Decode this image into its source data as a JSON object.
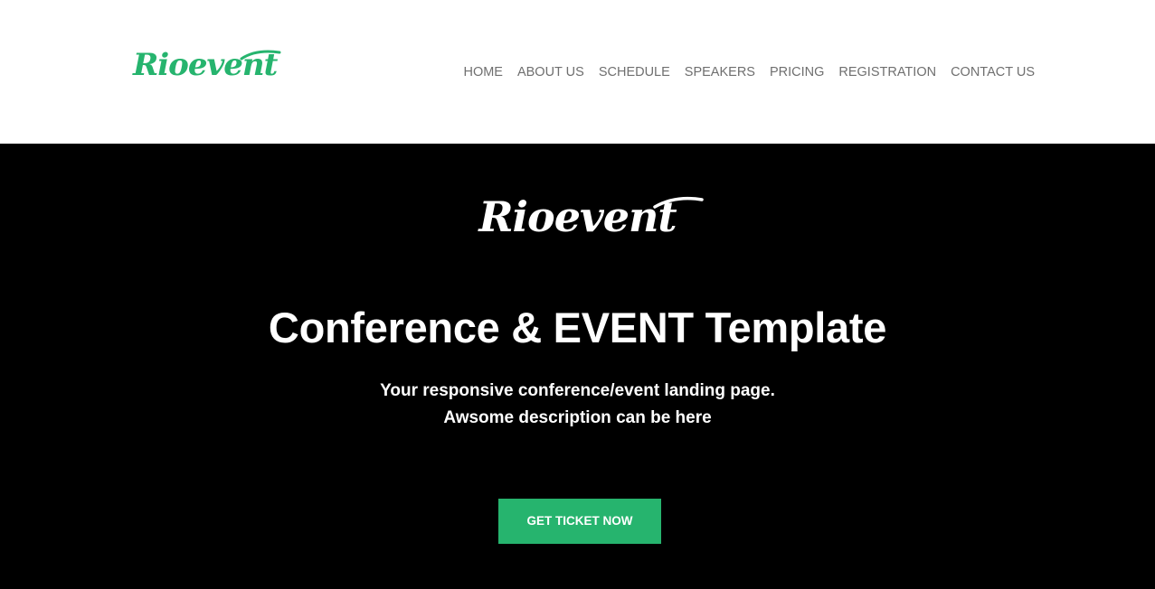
{
  "colors": {
    "brand_green": "#26b46e",
    "hero_background": "#000000",
    "hero_text": "#ffffff",
    "nav_text": "#6f6f6f",
    "header_background": "#ffffff"
  },
  "header": {
    "logo_text": "Rioevent",
    "nav": [
      {
        "label": "HOME"
      },
      {
        "label": "ABOUT US"
      },
      {
        "label": "SCHEDULE"
      },
      {
        "label": "SPEAKERS"
      },
      {
        "label": "PRICING"
      },
      {
        "label": "REGISTRATION"
      },
      {
        "label": "CONTACT US"
      }
    ]
  },
  "hero": {
    "logo_text": "Rioevent",
    "title": "Conference & EVENT Template",
    "subtitle_line1": "Your responsive conference/event landing page.",
    "subtitle_line2": "Awsome description can be here",
    "cta_label": "GET TICKET NOW"
  }
}
